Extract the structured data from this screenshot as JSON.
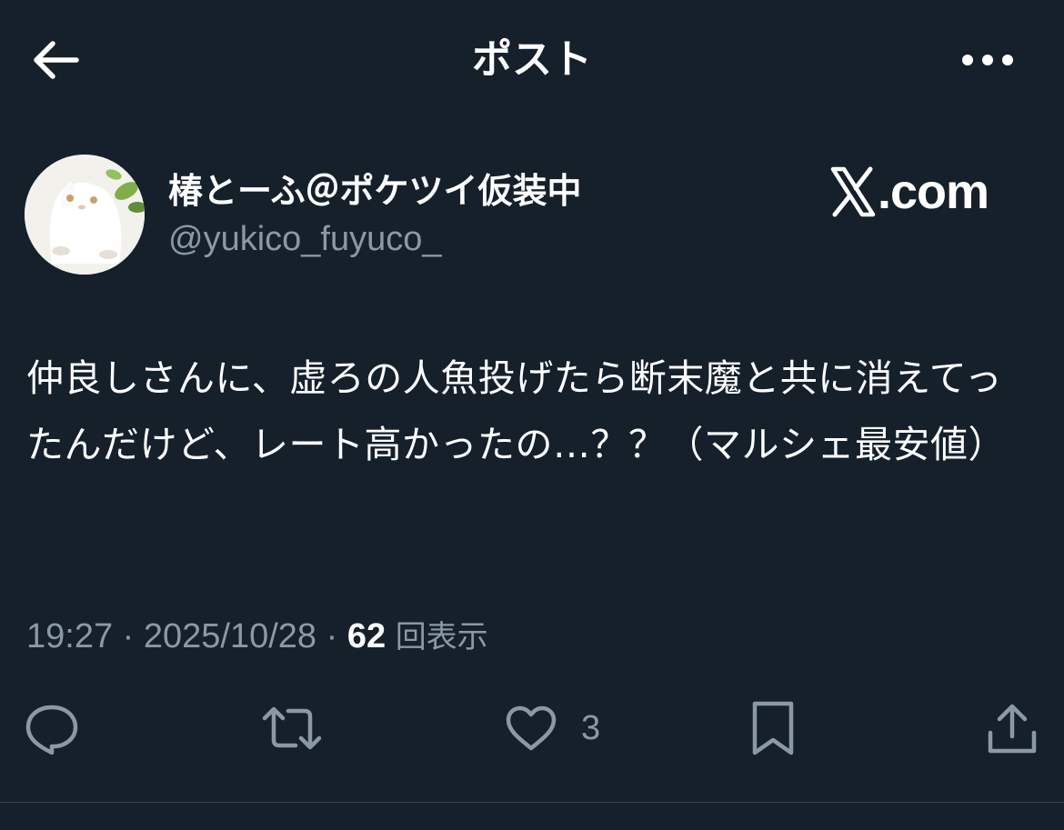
{
  "header": {
    "title": "ポスト",
    "back_icon": "arrow-left-icon",
    "more_icon": "ellipsis-icon"
  },
  "author": {
    "display_name": "椿とーふ＠ポケツイ仮装中",
    "handle": "@yukico_fuyuco_"
  },
  "watermark": {
    "text": ".com",
    "icon": "x-logo-icon"
  },
  "post": {
    "text": "仲良しさんに、虚ろの人魚投げたら断末魔と共に消えてったんだけど、レート高かったの…？？（マルシェ最安値）",
    "time": "19:27",
    "date": "2025/10/28",
    "separator": " · ",
    "views_count": "62",
    "views_label": "回表示"
  },
  "actions": {
    "reply_icon": "reply-icon",
    "repost_icon": "repost-icon",
    "like_icon": "heart-icon",
    "like_count": "3",
    "bookmark_icon": "bookmark-icon",
    "share_icon": "share-icon"
  },
  "colors": {
    "background": "#15202b",
    "text": "#ffffff",
    "secondary": "#8b98a5",
    "divider": "#38444d"
  }
}
